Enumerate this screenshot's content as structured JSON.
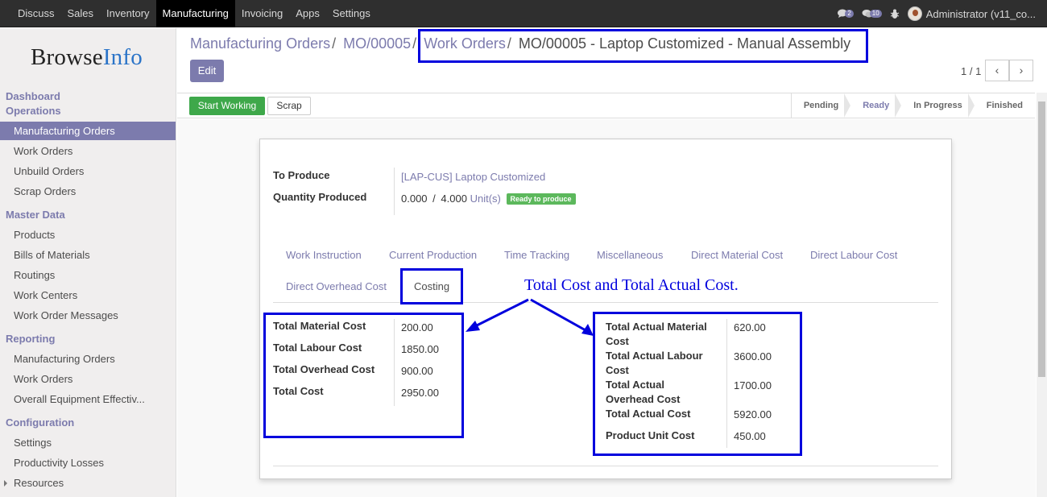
{
  "topbar": {
    "menu": [
      "Discuss",
      "Sales",
      "Inventory",
      "Manufacturing",
      "Invoicing",
      "Apps",
      "Settings"
    ],
    "active": "Manufacturing",
    "messages_count": "2",
    "activities_count": "10",
    "user": "Administrator (v11_co..."
  },
  "sidebar": {
    "logo_a": "Browse",
    "logo_b": "Info",
    "dashboard": "Dashboard",
    "operations": "Operations",
    "operations_items": [
      "Manufacturing Orders",
      "Work Orders",
      "Unbuild Orders",
      "Scrap Orders"
    ],
    "master_data": "Master Data",
    "master_items": [
      "Products",
      "Bills of Materials",
      "Routings",
      "Work Centers",
      "Work Order Messages"
    ],
    "reporting": "Reporting",
    "reporting_items": [
      "Manufacturing Orders",
      "Work Orders",
      "Overall Equipment Effectiv..."
    ],
    "configuration": "Configuration",
    "configuration_items": [
      "Settings",
      "Productivity Losses",
      "Resources"
    ]
  },
  "breadcrumb": {
    "b1": "Manufacturing Orders",
    "b2": "MO/00005",
    "b3": "Work Orders",
    "current": "MO/00005 - Laptop Customized - Manual Assembly",
    "sep": "/"
  },
  "buttons": {
    "edit": "Edit",
    "start": "Start Working",
    "scrap": "Scrap"
  },
  "pager": {
    "text": "1 / 1",
    "prev": "‹",
    "next": "›"
  },
  "stages": [
    "Pending",
    "Ready",
    "In Progress",
    "Finished"
  ],
  "current_stage": "Ready",
  "form": {
    "to_produce_label": "To Produce",
    "to_produce_value": "[LAP-CUS] Laptop Customized",
    "qty_label": "Quantity Produced",
    "qty_done": "0.000",
    "qty_sep": "/",
    "qty_total": "4.000",
    "qty_uom": "Unit(s)",
    "qty_badge": "Ready to produce"
  },
  "tabs": [
    "Work Instruction",
    "Current Production",
    "Time Tracking",
    "Miscellaneous",
    "Direct Material Cost",
    "Direct Labour Cost",
    "Direct Overhead Cost",
    "Costing"
  ],
  "active_tab": "Costing",
  "costing_left": [
    {
      "label": "Total Material Cost",
      "value": "200.00"
    },
    {
      "label": "Total Labour Cost",
      "value": "1850.00"
    },
    {
      "label": "Total Overhead Cost",
      "value": "900.00"
    },
    {
      "label": "Total Cost",
      "value": "2950.00"
    }
  ],
  "costing_right": [
    {
      "label_1": "Total Actual Material",
      "label_2": "Cost",
      "value": "620.00"
    },
    {
      "label_1": "Total Actual Labour",
      "label_2": "Cost",
      "value": "3600.00"
    },
    {
      "label_1": "Total Actual",
      "label_2": "Overhead Cost",
      "value": "1700.00"
    },
    {
      "label_1": "Total Actual Cost",
      "label_2": "",
      "value": "5920.00"
    },
    {
      "label_1": "Product Unit Cost",
      "label_2": "",
      "value": "450.00"
    }
  ],
  "annotation": "Total Cost and Total Actual Cost.",
  "colors": {
    "brand": "#7c7bad",
    "highlight": "#0000dd",
    "success": "#5cb85c",
    "topbar": "#2f2f2f"
  }
}
